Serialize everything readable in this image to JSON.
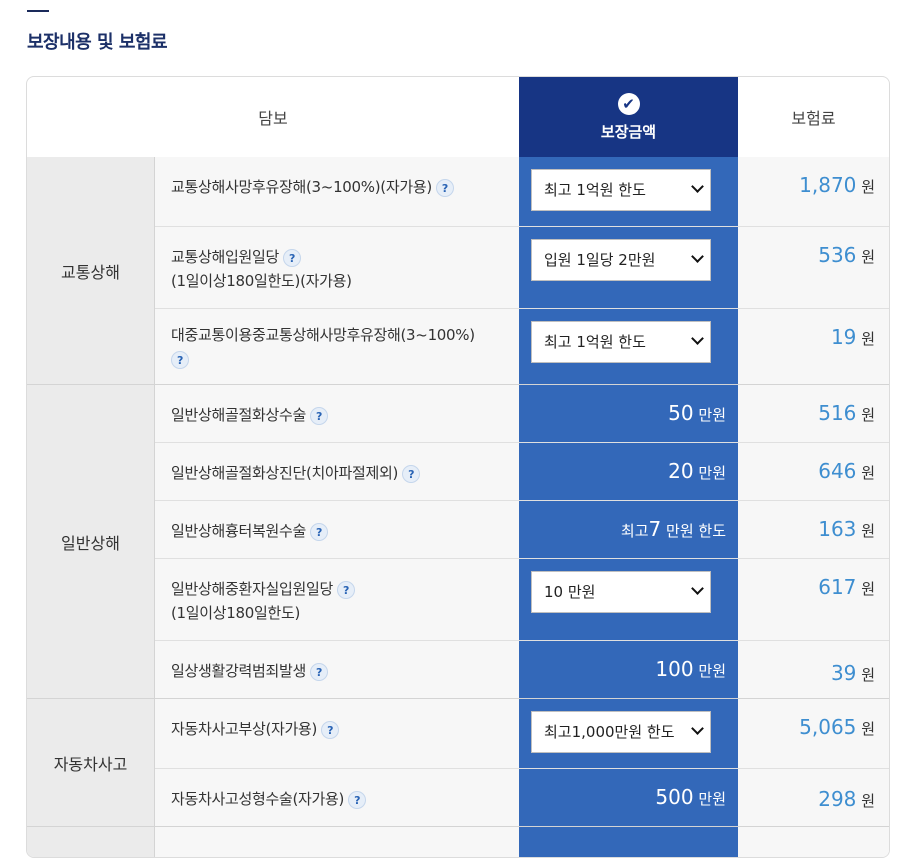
{
  "page": {
    "title": "보장내용 및 보험료"
  },
  "header": {
    "coverage": "담보",
    "amount": "보장금액",
    "premium": "보험료",
    "check_icon": "✔"
  },
  "help_icon": "?",
  "categories": [
    "교통상해",
    "일반상해",
    "자동차사고"
  ],
  "rows": [
    {
      "name": "교통상해사망후유장해(3~100%)(자가용)",
      "name2": "",
      "select": "최고 1억원 한도",
      "fixed_num": "",
      "fixed_unit": "",
      "premium": "1,870",
      "unit": "원"
    },
    {
      "name": "교통상해입원일당",
      "name2": "(1일이상180일한도)(자가용)",
      "select": "입원 1일당 2만원",
      "fixed_num": "",
      "fixed_unit": "",
      "premium": "536",
      "unit": "원"
    },
    {
      "name": "대중교통이용중교통상해사망후유장해(3~100%)",
      "name2": "",
      "select": "최고 1억원 한도",
      "fixed_num": "",
      "fixed_unit": "",
      "premium": "19",
      "unit": "원"
    },
    {
      "name": "일반상해골절화상수술",
      "name2": "",
      "select": "",
      "fixed_num": "50",
      "fixed_unit": "만원",
      "premium": "516",
      "unit": "원"
    },
    {
      "name": "일반상해골절화상진단(치아파절제외)",
      "name2": "",
      "select": "",
      "fixed_num": "20",
      "fixed_unit": "만원",
      "premium": "646",
      "unit": "원"
    },
    {
      "name": "일반상해흉터복원수술",
      "name2": "",
      "select": "",
      "fixed_pre": "최고",
      "fixed_num": "7",
      "fixed_unit": "만원 한도",
      "premium": "163",
      "unit": "원"
    },
    {
      "name": "일반상해중환자실입원일당",
      "name2": "(1일이상180일한도)",
      "select": "10 만원",
      "fixed_num": "",
      "fixed_unit": "",
      "premium": "617",
      "unit": "원"
    },
    {
      "name": "일상생활강력범죄발생",
      "name2": "",
      "select": "",
      "fixed_num": "100",
      "fixed_unit": "만원",
      "premium": "39",
      "unit": "원"
    },
    {
      "name": "자동차사고부상(자가용)",
      "name2": "",
      "select": "최고1,000만원 한도",
      "fixed_num": "",
      "fixed_unit": "",
      "premium": "5,065",
      "unit": "원"
    },
    {
      "name": "자동차사고성형수술(자가용)",
      "name2": "",
      "select": "",
      "fixed_num": "500",
      "fixed_unit": "만원",
      "premium": "298",
      "unit": "원"
    }
  ]
}
